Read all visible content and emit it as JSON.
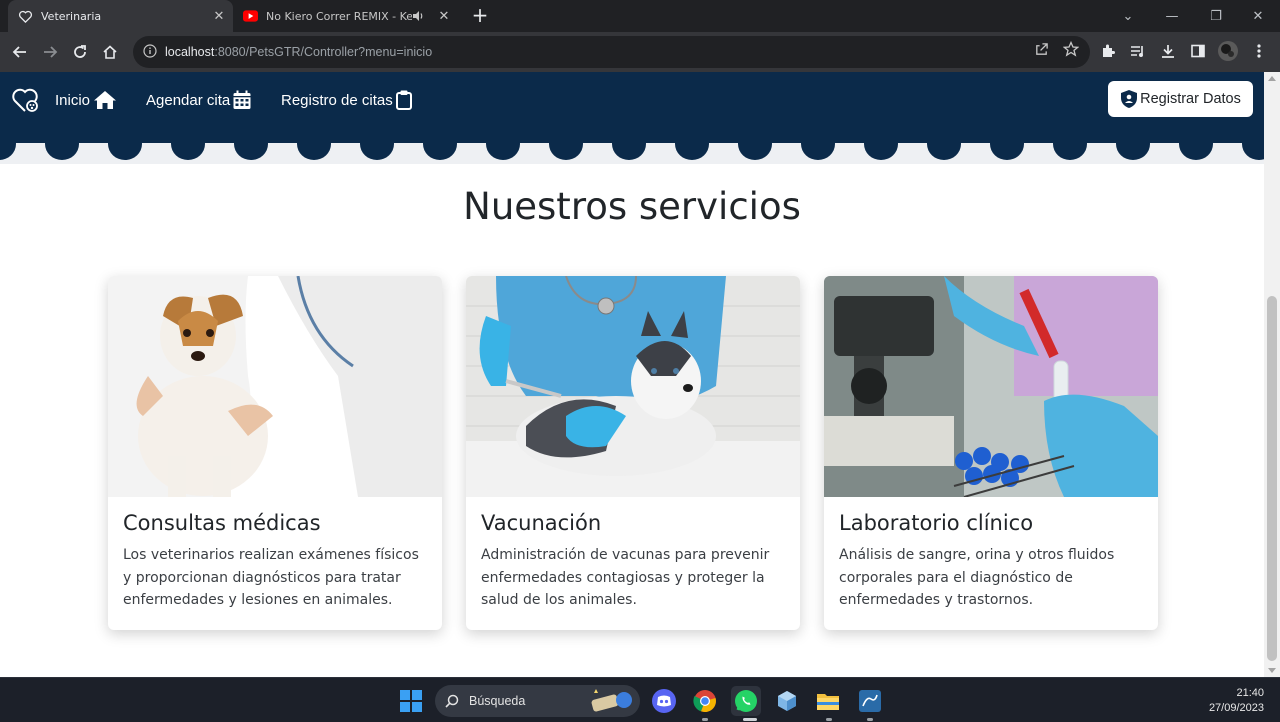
{
  "browser": {
    "tabs": [
      {
        "title": "Veterinaria",
        "icon": "paw-heart-icon",
        "active": true
      },
      {
        "title": "No Kiero Correr REMIX - Ke",
        "icon": "youtube-icon",
        "active": false,
        "audio": true
      }
    ],
    "url_host": "localhost",
    "url_rest": ":8080/PetsGTR/Controller?menu=inicio"
  },
  "navbar": {
    "links": [
      {
        "label": "Inicio",
        "icon": "home-icon"
      },
      {
        "label": "Agendar cita",
        "icon": "calendar-icon"
      },
      {
        "label": "Registro de citas",
        "icon": "clipboard-icon"
      }
    ],
    "register_button": "Registrar Datos",
    "color": "#0b2a4a"
  },
  "services": {
    "heading": "Nuestros servicios",
    "cards": [
      {
        "title": "Consultas médicas",
        "text": "Los veterinarios realizan exámenes físicos y proporcionan diagnósticos para tratar enfermedades y lesiones en animales.",
        "image": "dog-with-vet-photo"
      },
      {
        "title": "Vacunación",
        "text": "Administración de vacunas para prevenir enfermedades contagiosas y proteger la salud de los animales.",
        "image": "husky-puppy-vaccination-photo"
      },
      {
        "title": "Laboratorio clínico",
        "text": "Análisis de sangre, orina y otros fluidos corporales para el diagnóstico de enfermedades y trastornos.",
        "image": "lab-microscope-tubes-photo"
      }
    ]
  },
  "taskbar": {
    "search_placeholder": "Búsqueda",
    "time": "21:40",
    "date": "27/09/2023"
  }
}
